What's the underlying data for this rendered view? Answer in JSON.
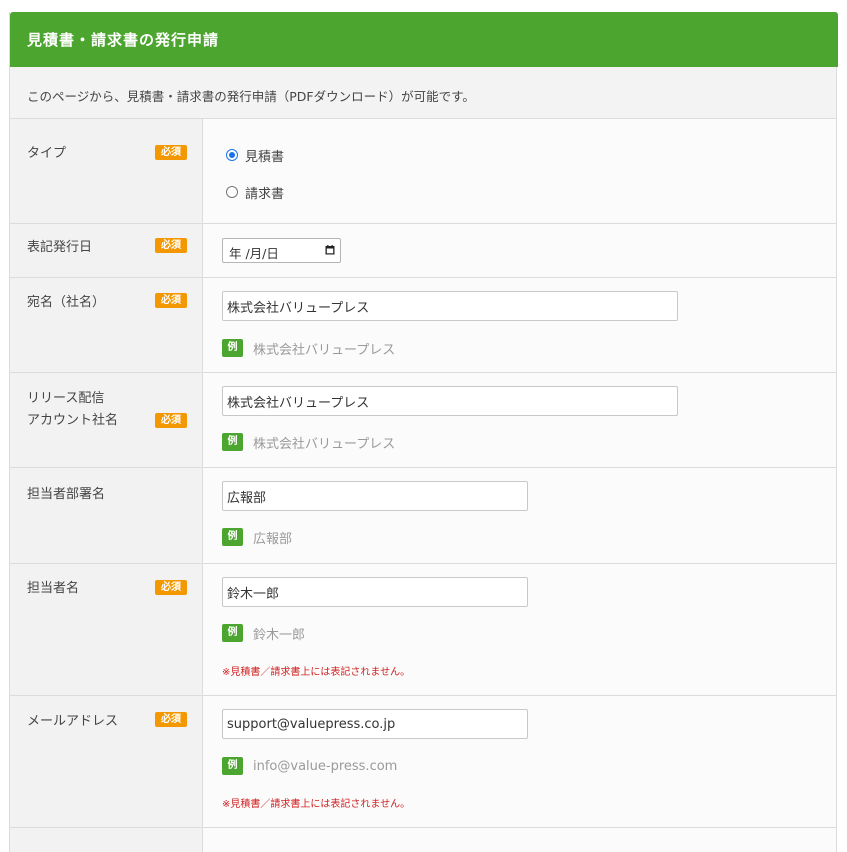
{
  "header": {
    "title": "見積書・請求書の発行申請"
  },
  "intro": {
    "text": "このページから、見積書・請求書の発行申請（PDFダウンロード）が可能です。"
  },
  "badges": {
    "required": "必須",
    "example": "例"
  },
  "colors": {
    "header_green": "#4ca52f",
    "required_orange": "#f39800",
    "note_red": "#d32020"
  },
  "form": {
    "type": {
      "label": "タイプ",
      "options": [
        {
          "label": "見積書",
          "checked": true
        },
        {
          "label": "請求書",
          "checked": false
        }
      ]
    },
    "issue_date": {
      "label": "表記発行日",
      "value": "年 /月/日"
    },
    "addressee": {
      "label": "宛名（社名）",
      "value": "株式会社バリュープレス",
      "example": "株式会社バリュープレス"
    },
    "release_account": {
      "label_line1": "リリース配信",
      "label_line2": "アカウント社名",
      "value": "株式会社バリュープレス",
      "example": "株式会社バリュープレス"
    },
    "department": {
      "label": "担当者部署名",
      "value": "広報部",
      "example": "広報部"
    },
    "person": {
      "label": "担当者名",
      "value": "鈴木一郎",
      "example": "鈴木一郎",
      "note": "※見積書／請求書上には表記されません。"
    },
    "email": {
      "label": "メールアドレス",
      "value": "support@valuepress.co.jp",
      "example": "info@value-press.com",
      "note": "※見積書／請求書上には表記されません。"
    }
  }
}
